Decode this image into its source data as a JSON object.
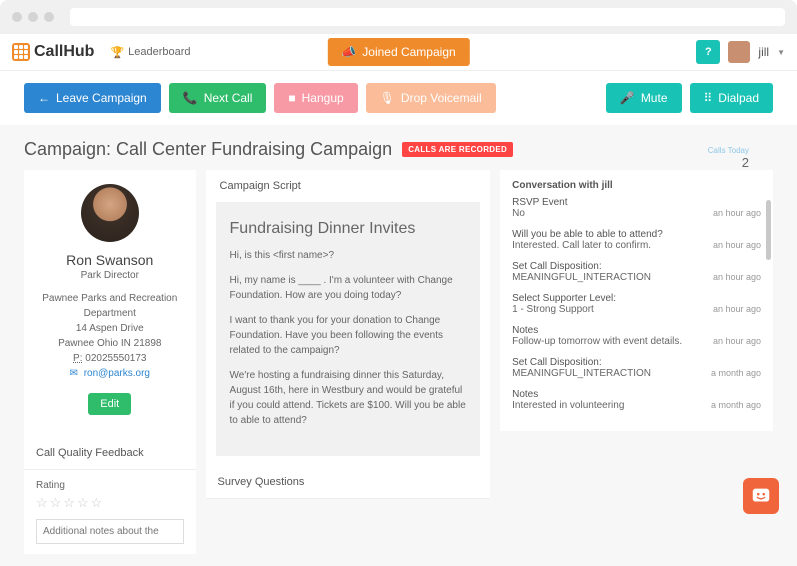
{
  "brand": {
    "name": "CallHub"
  },
  "header": {
    "leaderboard_label": "Leaderboard",
    "joined_campaign_label": "Joined Campaign",
    "help_label": "?",
    "user_name": "jill"
  },
  "actions": {
    "leave": "Leave Campaign",
    "next": "Next Call",
    "hangup": "Hangup",
    "drop_voicemail": "Drop Voicemail",
    "mute": "Mute",
    "dialpad": "Dialpad"
  },
  "calls_today": {
    "label": "Calls Today",
    "count": "2"
  },
  "campaign": {
    "title": "Campaign: Call Center Fundraising Campaign",
    "recorded_badge": "CALLS ARE RECORDED"
  },
  "contact": {
    "name": "Ron Swanson",
    "title": "Park Director",
    "org": "Pawnee Parks and Recreation Department",
    "address1": "14 Aspen Drive",
    "address2": "Pawnee Ohio IN 21898",
    "phone_label": "P:",
    "phone": "02025550173",
    "email": "ron@parks.org",
    "edit_label": "Edit"
  },
  "feedback": {
    "header": "Call Quality Feedback",
    "rating_label": "Rating",
    "notes_placeholder": "Additional notes about the"
  },
  "script": {
    "header": "Campaign Script",
    "title": "Fundraising Dinner Invites",
    "p1": "Hi, is this <first name>?",
    "p2": "Hi, my name is ____ . I'm a volunteer with Change Foundation. How are you doing today?",
    "p3": "I want to thank you for your donation to Change Foundation. Have you been following the events related to the campaign?",
    "p4": "We're hosting a fundraising dinner this Saturday, August 16th, here in Westbury and would be grateful if you could attend. Tickets are $100. Will you be able to able to attend?"
  },
  "survey": {
    "header": "Survey Questions"
  },
  "conversation": {
    "header": "Conversation with jill",
    "items": [
      {
        "q": "RSVP Event",
        "a": "No",
        "time": "an hour ago"
      },
      {
        "q": "Will you be able to able to attend?",
        "a": "Interested. Call later to confirm.",
        "time": "an hour ago"
      },
      {
        "q": "Set Call Disposition:",
        "a": "MEANINGFUL_INTERACTION",
        "time": "an hour ago"
      },
      {
        "q": "Select Supporter Level:",
        "a": "1 - Strong Support",
        "time": "an hour ago"
      },
      {
        "q": "Notes",
        "a": "Follow-up tomorrow with event details.",
        "time": "an hour ago"
      },
      {
        "q": "Set Call Disposition:",
        "a": "MEANINGFUL_INTERACTION",
        "time": "a month ago"
      },
      {
        "q": "Notes",
        "a": "Interested in volunteering",
        "time": "a month ago"
      }
    ]
  }
}
